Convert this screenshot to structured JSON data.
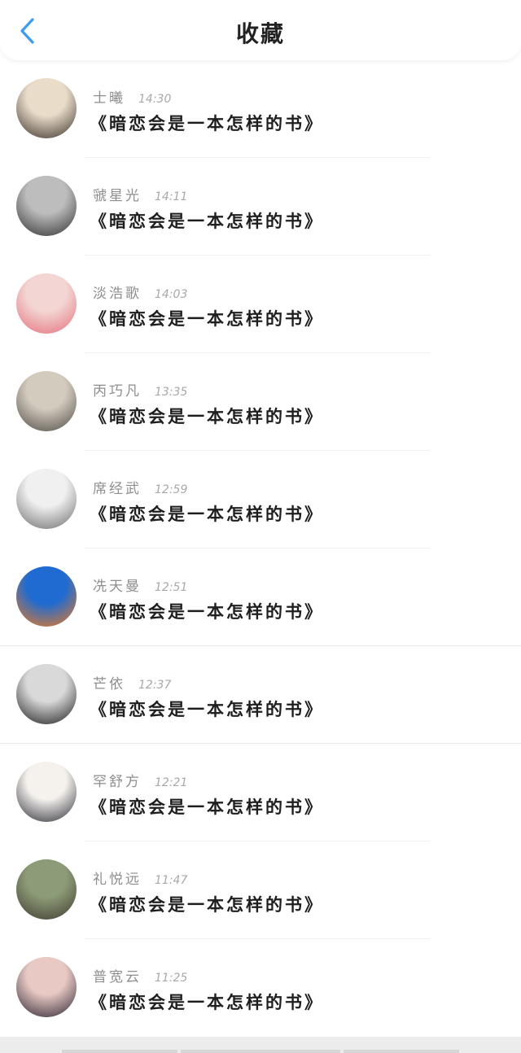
{
  "header": {
    "title": "收藏",
    "back_icon": "chevron-left-icon",
    "accent_color": "#3a9bf0"
  },
  "items": [
    {
      "name": "士曦",
      "time": "14:30",
      "title": "《暗恋会是一本怎样的书》",
      "avatar_colors": [
        "#e9dcc9",
        "#3a2f29"
      ]
    },
    {
      "name": "虢星光",
      "time": "14:11",
      "title": "《暗恋会是一本怎样的书》",
      "avatar_colors": [
        "#bdbdbd",
        "#2f2f2f"
      ]
    },
    {
      "name": "淡浩歌",
      "time": "14:03",
      "title": "《暗恋会是一本怎样的书》",
      "avatar_colors": [
        "#f3d6d3",
        "#e46f7b"
      ]
    },
    {
      "name": "丙巧凡",
      "time": "13:35",
      "title": "《暗恋会是一本怎样的书》",
      "avatar_colors": [
        "#d4cbbf",
        "#4d4a45"
      ]
    },
    {
      "name": "席经武",
      "time": "12:59",
      "title": "《暗恋会是一本怎样的书》",
      "avatar_colors": [
        "#f0f0f0",
        "#6b6b6b"
      ]
    },
    {
      "name": "冼天曼",
      "time": "12:51",
      "title": "《暗恋会是一本怎样的书》",
      "avatar_colors": [
        "#1f6bd1",
        "#f07a1c"
      ]
    },
    {
      "name": "芒依",
      "time": "12:37",
      "title": "《暗恋会是一本怎样的书》",
      "avatar_colors": [
        "#d9d9d9",
        "#1a1a1a"
      ]
    },
    {
      "name": "罕舒方",
      "time": "12:21",
      "title": "《暗恋会是一本怎样的书》",
      "avatar_colors": [
        "#f5f2ee",
        "#2b2b35"
      ]
    },
    {
      "name": "礼悦远",
      "time": "11:47",
      "title": "《暗恋会是一本怎样的书》",
      "avatar_colors": [
        "#8d9c78",
        "#3f3a2f"
      ]
    },
    {
      "name": "普宽云",
      "time": "11:25",
      "title": "《暗恋会是一本怎样的书》",
      "avatar_colors": [
        "#e8c9c4",
        "#2a2230"
      ]
    }
  ]
}
